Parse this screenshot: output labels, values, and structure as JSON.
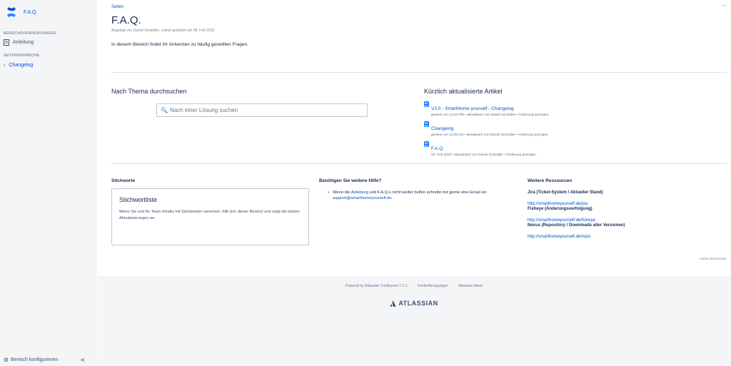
{
  "sidebar": {
    "space_name": "F.A.Q.",
    "section_shortcuts": "BEREICHSVERKNÜPFUNGEN",
    "shortcut_item": "Anleitung",
    "section_tree": "SEITENHIERARCHIE",
    "tree_item": "Changelog",
    "configure": "Bereich konfigurieren",
    "collapse": "«"
  },
  "page": {
    "breadcrumb": "Seiten",
    "more": "···",
    "title": "F.A.Q.",
    "byline": "Angelegt von Daniel Scheidler, zuletzt geändert am 08. Feb 2020",
    "intro": "In diesem Bereich findet Ihr Antworten zu häufig gestellten Fragen."
  },
  "topic_search": {
    "heading": "Nach Thema durchsuchen",
    "placeholder": "Nach einer Lösung suchen"
  },
  "recent": {
    "heading": "Kürzlich aktualisierte Artikel",
    "items": [
      {
        "title": "V2.0 - SmartHome yourself - Changelog",
        "meta": "gestern um 12:04 PM • aktualisiert von Daniel Scheidler • Änderung anzeigen"
      },
      {
        "title": "Changelog",
        "meta": "gestern um 11:08 AM • aktualisiert von Daniel Scheidler • Änderung anzeigen"
      },
      {
        "title": "F.A.Q.",
        "meta": "08. Feb 2020 • aktualisiert von Daniel Scheidler • Änderung anzeigen"
      }
    ]
  },
  "tags": {
    "heading": "Stichworte",
    "box_title": "Stichwortliste",
    "box_text": "Wenn Sie und Ihr Team Inhalte mit Stichworten versehen, füllt sich dieser Bereich und zeigt die letzten Aktualisierungen an.",
    "no_tags": "Keine Stichwörter"
  },
  "help": {
    "heading": "Benötigen Sie weitere Hilfe?",
    "text_1": "Wenn die ",
    "link_1": "Anleitung",
    "text_2": " und F.A.Q.s nicht weiter helfen schreibt mir gerne eine Email an: ",
    "email": "support@smarthomeyourself.de"
  },
  "resources": {
    "heading": "Weitere Ressourcen",
    "items": [
      {
        "name": "Jira (Ticket-System / Aktueller Stand)",
        "url": "http://smarthomeyourself.de/jira"
      },
      {
        "name": "Fisheye (Änderungsverfolgung)",
        "url": "http://smarthomeyourself.de/fisheye"
      },
      {
        "name": "Nexus (Repository / Downloads aller Versionen)",
        "url": "http://smarthomeyourself.de/repo"
      }
    ]
  },
  "footer": {
    "powered": "Powered by Atlassian Confluence 7.2.1",
    "sep": "·",
    "link_feedback": "Fehler/Anregungen",
    "link_news": "Atlassian-News",
    "brand": "ATLASSIAN"
  },
  "colors": {
    "link": "#0052cc",
    "brand_blue": "#2684ff",
    "sidebar_bg": "#f4f5f7"
  },
  "icons": [
    "confluence-logo-icon",
    "page-icon",
    "chevron-right-icon",
    "search-icon",
    "gear-icon",
    "atlassian-logo-icon"
  ]
}
